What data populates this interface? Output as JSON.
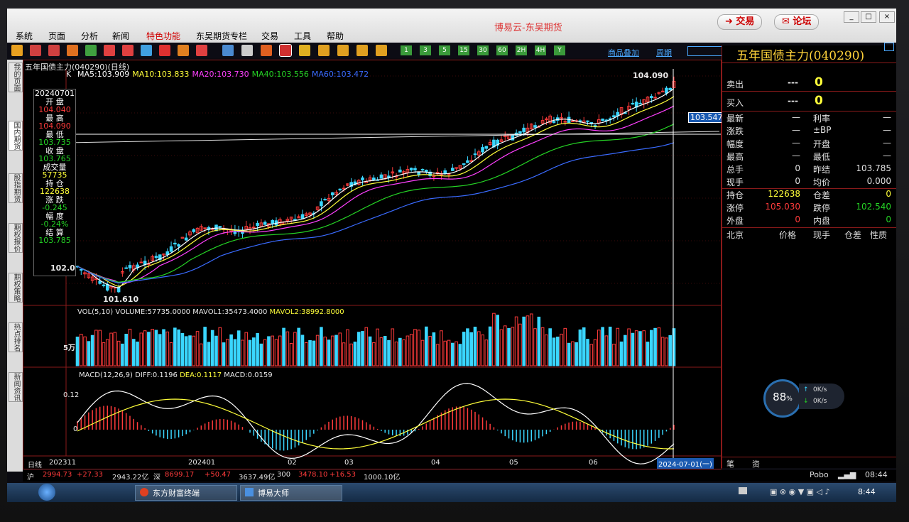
{
  "app": {
    "title": "博易云-东吴期货",
    "trade_btn": "交易",
    "forum_btn": "论坛",
    "menus": [
      "系统",
      "页面",
      "分析",
      "新闻",
      "特色功能",
      "东吴期货专栏",
      "交易",
      "工具",
      "帮助"
    ],
    "highlight_menu": "特色功能"
  },
  "toolbar": {
    "period_buttons": [
      "1",
      "3",
      "5",
      "15",
      "30",
      "60",
      "2H",
      "4H",
      "Y"
    ],
    "link_add_product": "商品叠加",
    "link_period": "周期"
  },
  "left_tabs": [
    "我的页面",
    "国内期货",
    "股指期货",
    "期权报价",
    "期权策略",
    "热点排名",
    "新闻资讯"
  ],
  "chart": {
    "header": "五年国债主力(040290)(日线)",
    "k_label": "K",
    "ma": [
      {
        "text": "MA5:103.909",
        "color": "#ffffff"
      },
      {
        "text": "MA10:103.833",
        "color": "#ffff3a"
      },
      {
        "text": "MA20:103.730",
        "color": "#ff40ff"
      },
      {
        "text": "MA40:103.556",
        "color": "#25d325"
      },
      {
        "text": "MA60:103.472",
        "color": "#3a6bff"
      }
    ],
    "high_label": "104.090",
    "low_label": "101.610",
    "price_axis_label": "102.0",
    "crosshair_value": "103.547",
    "vol_header": {
      "a": "VOL(5,10) VOLUME:57735.0000 MAVOL1:35473.4000",
      "b": "MAVOL2:38992.8000"
    },
    "vol_axis": "5万",
    "macd_header": {
      "a": "MACD(12,26,9) DIFF:0.1196",
      "b": "DEA:0.1117",
      "c": "MACD:0.0159"
    },
    "macd_axis": [
      "0.12",
      "0"
    ],
    "x_axis": [
      "日线",
      "202311",
      "202401",
      "02",
      "03",
      "04",
      "05",
      "06"
    ],
    "date_box": "2024-07-01(一)"
  },
  "info_box": [
    {
      "text": "20240701",
      "color": "#ffffff"
    },
    {
      "text": "开 盘",
      "color": "#ffffff"
    },
    {
      "text": "104.040",
      "color": "#ff3b3b"
    },
    {
      "text": "最 高",
      "color": "#ffffff"
    },
    {
      "text": "104.090",
      "color": "#ff3b3b"
    },
    {
      "text": "最 低",
      "color": "#ffffff"
    },
    {
      "text": "103.735",
      "color": "#25d325"
    },
    {
      "text": "收 盘",
      "color": "#ffffff"
    },
    {
      "text": "103.765",
      "color": "#25d325"
    },
    {
      "text": "成交量",
      "color": "#ffffff"
    },
    {
      "text": "57735",
      "color": "#ffff3a"
    },
    {
      "text": "持 仓",
      "color": "#ffffff"
    },
    {
      "text": "122638",
      "color": "#ffff3a"
    },
    {
      "text": "涨 跌",
      "color": "#ffffff"
    },
    {
      "text": "-0.245",
      "color": "#25d325"
    },
    {
      "text": "幅 度",
      "color": "#ffffff"
    },
    {
      "text": "-0.24%",
      "color": "#25d325"
    },
    {
      "text": "结 算",
      "color": "#ffffff"
    },
    {
      "text": "103.785",
      "color": "#25d325"
    }
  ],
  "quote": {
    "title": "五年国债主力(040290)",
    "sell_label": "卖出",
    "sell_price": "---",
    "sell_vol": "0",
    "buy_label": "买入",
    "buy_price": "---",
    "buy_vol": "0",
    "rows": [
      {
        "k": "最新",
        "v1": "—",
        "k2": "利率",
        "v2": "—",
        "c2": "#e0e0e0"
      },
      {
        "k": "涨跌",
        "v1": "—",
        "k2": "±BP",
        "v2": "—",
        "c2": "#e0e0e0"
      },
      {
        "k": "幅度",
        "v1": "—",
        "k2": "开盘",
        "v2": "—",
        "c2": "#e0e0e0"
      },
      {
        "k": "最高",
        "v1": "—",
        "k2": "最低",
        "v2": "—",
        "c2": "#e0e0e0"
      },
      {
        "k": "总手",
        "v1": "0",
        "k2": "昨结",
        "v2": "103.785",
        "c2": "#e0e0e0"
      },
      {
        "k": "现手",
        "v1": "0",
        "k2": "均价",
        "v2": "0.000",
        "c2": "#e0e0e0"
      },
      {
        "k": "持仓",
        "v1": "122638",
        "v1c": "#ffff3a",
        "k2": "仓差",
        "v2": "0",
        "c2": "#ffff3a"
      },
      {
        "k": "涨停",
        "v1": "105.030",
        "v1c": "#ff3b3b",
        "k2": "跌停",
        "v2": "102.540",
        "c2": "#25d325"
      },
      {
        "k": "外盘",
        "v1": "0",
        "v1c": "#ff3b3b",
        "k2": "内盘",
        "v2": "0",
        "c2": "#25d325"
      }
    ],
    "tick_headers": [
      "北京",
      "价格",
      "现手",
      "仓差",
      "性质"
    ],
    "gauge": "88",
    "gauge_unit": "%",
    "speed_up": "0K/s",
    "speed_down": "0K/s",
    "bottom_tabs": [
      "笔",
      "资"
    ]
  },
  "statusbar": {
    "items": [
      {
        "text": "沪",
        "color": "#e0e0e0"
      },
      {
        "text": "2994.73",
        "color": "#ff3b3b"
      },
      {
        "text": "+27.33",
        "color": "#ff3b3b"
      },
      {
        "text": "2943.22亿",
        "color": "#e0e0e0"
      },
      {
        "text": "深",
        "color": "#e0e0e0"
      },
      {
        "text": "8699.17",
        "color": "#ff3b3b"
      },
      {
        "text": "+50.47",
        "color": "#ff3b3b"
      },
      {
        "text": "3637.49亿",
        "color": "#e0e0e0"
      },
      {
        "text": "300",
        "color": "#e0e0e0"
      },
      {
        "text": "3478.10",
        "color": "#ff3b3b"
      },
      {
        "text": "+16.53",
        "color": "#ff3b3b"
      },
      {
        "text": "1000.10亿",
        "color": "#e0e0e0"
      }
    ],
    "brand": "Pobo",
    "time": "08:44"
  },
  "taskbar": {
    "apps": [
      "东方财富终端",
      "博易大师"
    ],
    "clock": "8:44"
  }
}
